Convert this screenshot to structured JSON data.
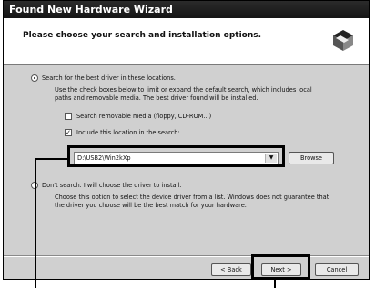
{
  "window": {
    "title": "Found New Hardware Wizard",
    "heading": "Please choose your search and installation options."
  },
  "search_option": {
    "label": "Search for the best driver in these locations.",
    "description_line1": "Use the check boxes below to limit or expand the default search, which includes local",
    "description_line2": "paths and removable media. The best driver found will be installed.",
    "removable_media_label": "Search removable media (floppy, CD-ROM...)",
    "include_location_label": "Include this location in the search:",
    "location_path": "D:\\USB2\\Win2kXp",
    "browse_label": "Browse"
  },
  "dont_search_option": {
    "label": "Don't search. I will choose the driver to install.",
    "description_line1": "Choose this option to select the device driver from a list. Windows does not guarantee that",
    "description_line2": "the driver you choose will be the best match for your hardware."
  },
  "buttons": {
    "back": "< Back",
    "next": "Next >",
    "cancel": "Cancel"
  },
  "state": {
    "search_selected": true,
    "removable_media_checked": false,
    "include_location_checked": true
  }
}
